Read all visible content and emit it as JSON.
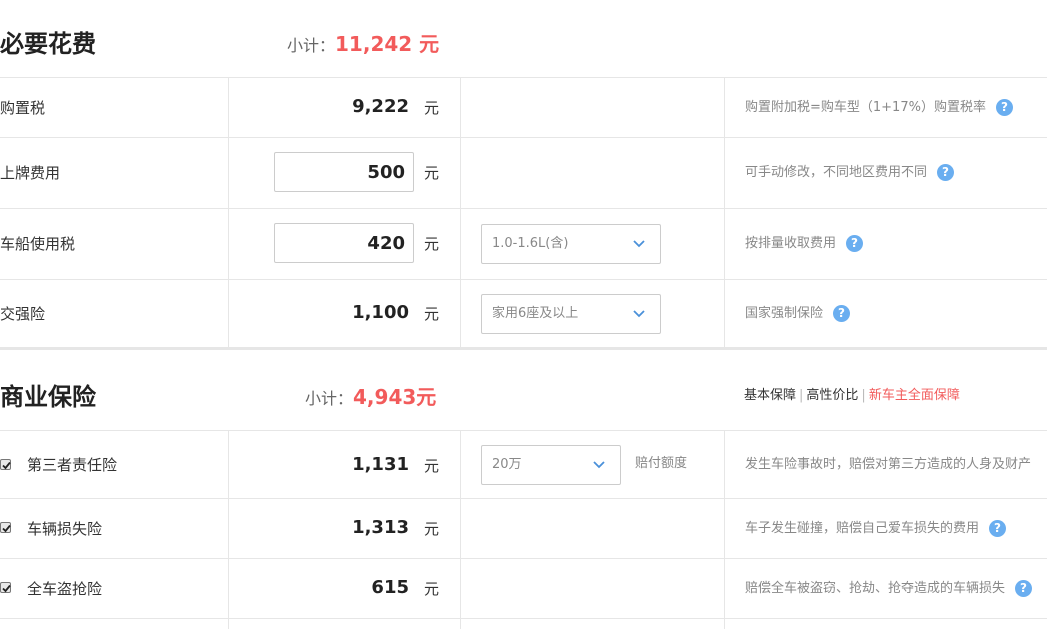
{
  "required": {
    "title": "必要花费",
    "subtotal_label": "小计：",
    "subtotal_value": "11,242 元",
    "rows": [
      {
        "label": "购置税",
        "value": "9,222",
        "unit": "元",
        "desc": "购置附加税=购车型（1+17%）购置税率"
      },
      {
        "label": "上牌费用",
        "value": "500",
        "unit": "元",
        "desc": "可手动修改，不同地区费用不同"
      },
      {
        "label": "车船使用税",
        "value": "420",
        "unit": "元",
        "select": "1.0-1.6L(含)",
        "desc": "按排量收取费用"
      },
      {
        "label": "交强险",
        "value": "1,100",
        "unit": "元",
        "select": "家用6座及以上",
        "desc": "国家强制保险"
      }
    ]
  },
  "commercial": {
    "title": "商业保险",
    "subtotal_label": "小计：",
    "subtotal_value": "4,943元",
    "links": [
      "基本保障",
      "高性价比",
      "新车主全面保障"
    ],
    "rows": [
      {
        "label": "第三者责任险",
        "value": "1,131",
        "unit": "元",
        "select": "20万",
        "payout_label": "赔付额度",
        "desc": "发生车险事故时，赔偿对第三方造成的人身及财产",
        "checked": true
      },
      {
        "label": "车辆损失险",
        "value": "1,313",
        "unit": "元",
        "desc": "车子发生碰撞，赔偿自己爱车损失的费用",
        "checked": true
      },
      {
        "label": "全车盗抢险",
        "value": "615",
        "unit": "元",
        "desc": "赔偿全车被盗窃、抢劫、抢夺造成的车辆损失",
        "checked": true
      }
    ]
  },
  "icons": {
    "help": "?"
  },
  "colors": {
    "accent": "#f25b5b",
    "help": "#6aaef0"
  }
}
